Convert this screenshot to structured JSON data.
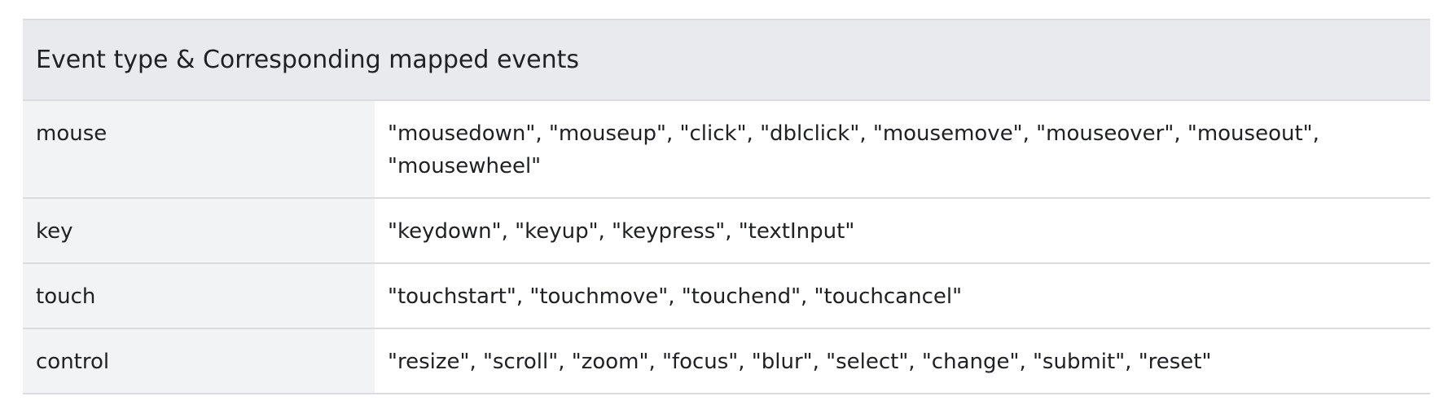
{
  "table": {
    "header": "Event type & Corresponding mapped events",
    "rows": [
      {
        "type": "mouse",
        "events": "\"mousedown\", \"mouseup\", \"click\", \"dblclick\", \"mousemove\", \"mouseover\", \"mouseout\", \"mousewheel\""
      },
      {
        "type": "key",
        "events": "\"keydown\", \"keyup\", \"keypress\", \"textInput\""
      },
      {
        "type": "touch",
        "events": "\"touchstart\", \"touchmove\", \"touchend\", \"touchcancel\""
      },
      {
        "type": "control",
        "events": "\"resize\", \"scroll\", \"zoom\", \"focus\", \"blur\", \"select\", \"change\", \"submit\", \"reset\""
      }
    ]
  }
}
